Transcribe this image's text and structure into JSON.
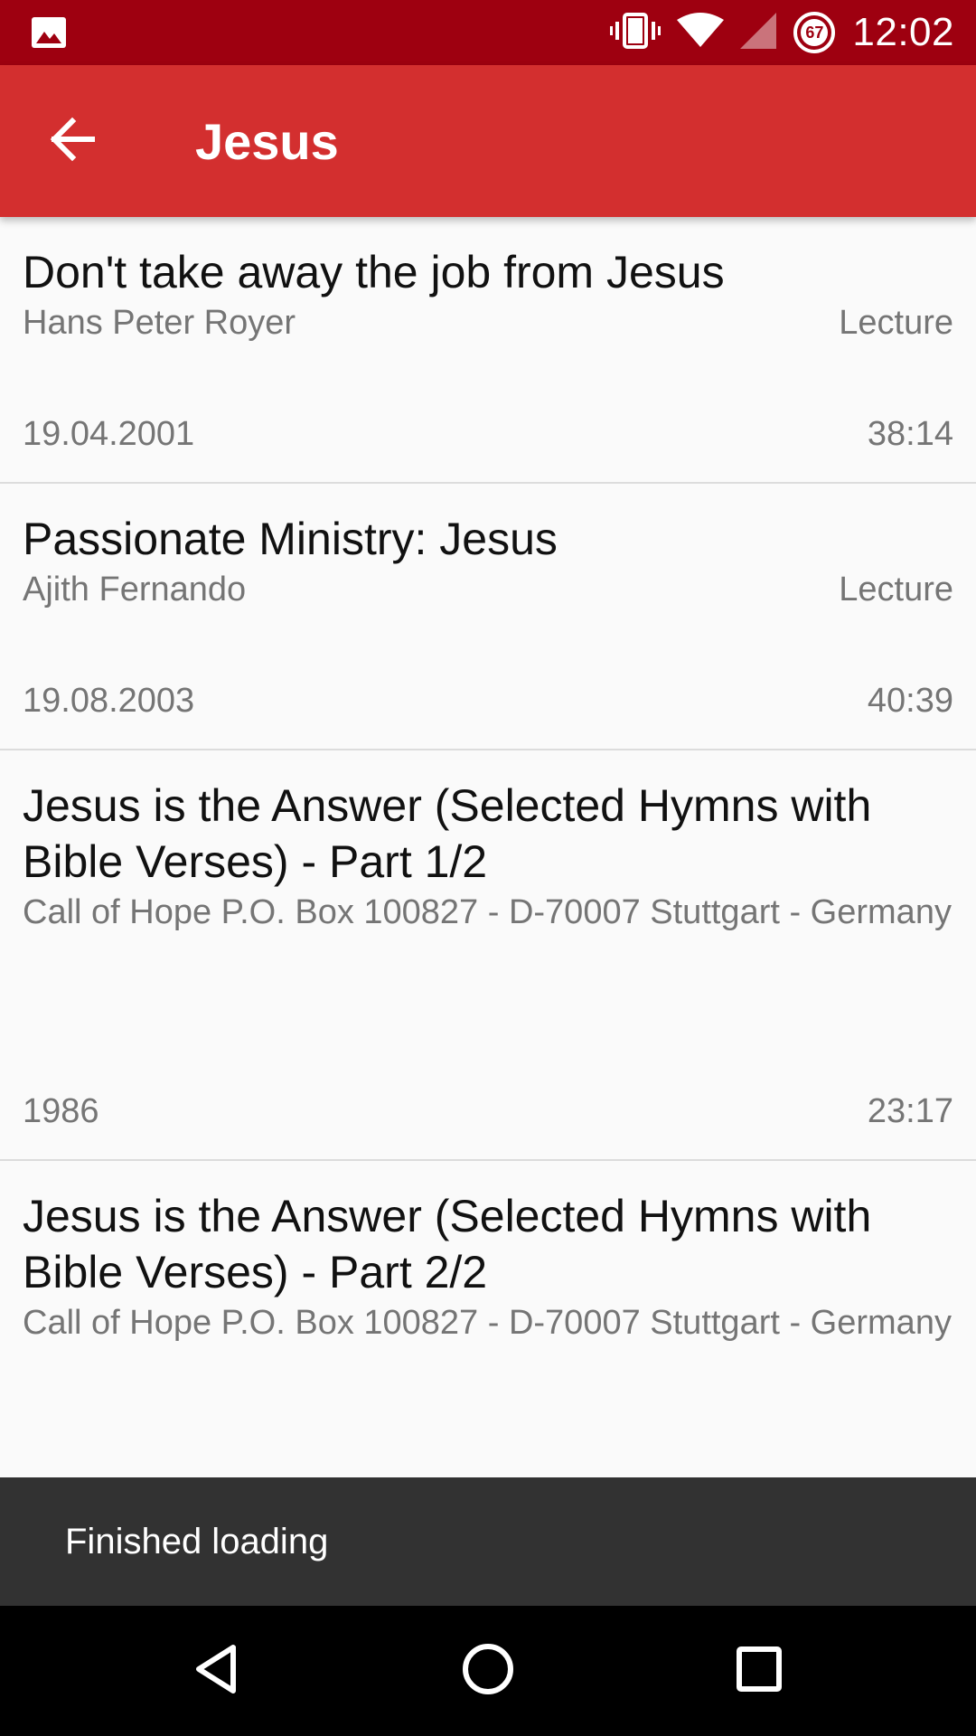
{
  "status_bar": {
    "time": "12:02",
    "battery_level": "67",
    "icons": [
      "image-icon",
      "vibrate-icon",
      "wifi-icon",
      "signal-icon",
      "battery-icon"
    ]
  },
  "app_bar": {
    "title": "Jesus",
    "back_icon": "arrow-back-icon",
    "color": "#d32f2f"
  },
  "list": {
    "items": [
      {
        "title": "Don't take away the job from Jesus",
        "author": "Hans Peter Royer",
        "type": "Lecture",
        "date": "19.04.2001",
        "duration": "38:14"
      },
      {
        "title": "Passionate Ministry: Jesus",
        "author": "Ajith Fernando",
        "type": "Lecture",
        "date": "19.08.2003",
        "duration": "40:39"
      },
      {
        "title": "Jesus is the Answer (Selected Hymns with Bible Verses) - Part 1/2",
        "author": "Call of Hope P.O. Box 100827 - D-70007 Stuttgart - Germany",
        "type": "",
        "date": "1986",
        "duration": "23:17"
      },
      {
        "title": "Jesus is the Answer (Selected Hymns with Bible Verses) - Part 2/2",
        "author": "Call of Hope P.O. Box 100827 - D-70007 Stuttgart - Germany",
        "type": "",
        "date": "",
        "duration": ""
      }
    ]
  },
  "snackbar": {
    "text": "Finished loading"
  },
  "nav_bar": {
    "icons": [
      "back-triangle-icon",
      "home-circle-icon",
      "recents-square-icon"
    ]
  }
}
